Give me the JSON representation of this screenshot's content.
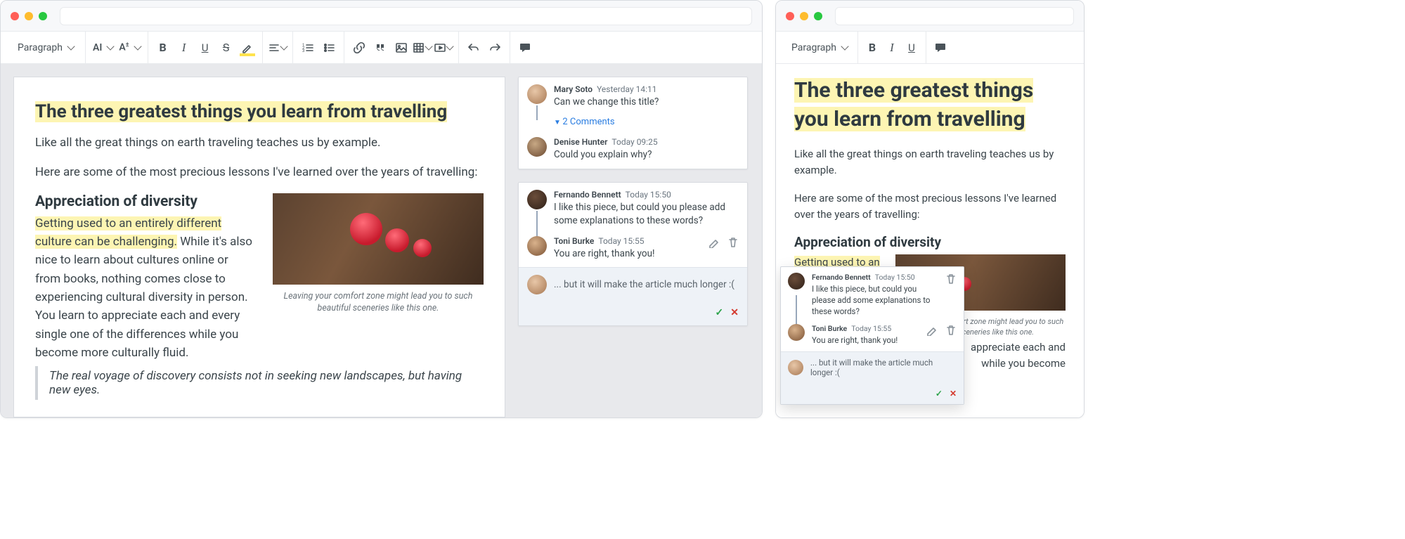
{
  "toolbar": {
    "paragraph_label": "Paragraph",
    "font_family_label": "AI",
    "font_size_label": "A"
  },
  "document": {
    "title": "The three greatest things you learn from travelling",
    "lead": "Like all the great things on earth traveling teaches us by example.",
    "intro": "Here are some of the most precious lessons I've learned over the years of travelling:",
    "section_heading": "Appreciation of diversity",
    "highlighted_span": "Getting used to an entirely different culture can be challenging.",
    "body_rest": " While it's also nice to learn about cultures online or from books, nothing comes close to experiencing cultural diversity in person. You learn to appreciate each and every single one of the differences while you become more culturally fluid.",
    "caption": "Leaving your comfort zone might lead you to such beautiful sceneries like this one.",
    "quote": "The real voyage of discovery consists not in seeking new landscapes, but having new eyes."
  },
  "right_doc": {
    "highlighted_span": "Getting used to an entirely different culture can be",
    "body_rest_a": "appreciate each and",
    "body_rest_b": "while you become",
    "caption": "Leaving your comfort zone might lead you to such beautiful sceneries like this one."
  },
  "comments": {
    "thread1": {
      "c1": {
        "author": "Mary Soto",
        "time": "Yesterday 14:11",
        "text": "Can we change this title?"
      },
      "toggle": "2 Comments",
      "c2": {
        "author": "Denise Hunter",
        "time": "Today 09:25",
        "text": "Could you explain why?"
      }
    },
    "thread2": {
      "c1": {
        "author": "Fernando Bennett",
        "time": "Today 15:50",
        "text": "I like this piece, but could you please add some explanations to these words?"
      },
      "c2": {
        "author": "Toni Burke",
        "time": "Today 15:55",
        "text": "You are right, thank you!"
      },
      "reply_draft": "... but it will make the article much longer :("
    }
  }
}
